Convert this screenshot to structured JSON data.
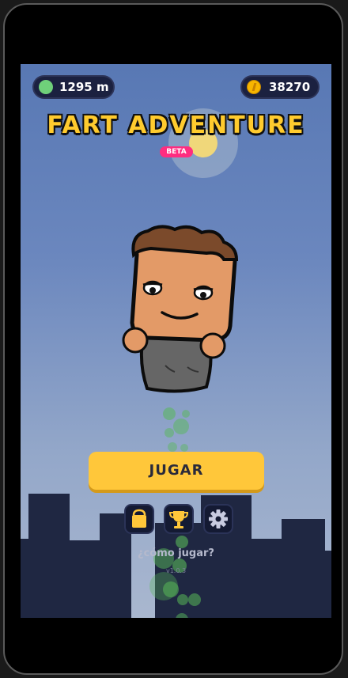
{
  "hud": {
    "distance": "1295 m",
    "coins": "38270"
  },
  "title": "FART ADVENTURE",
  "badge": "BETA",
  "play_button": "JUGAR",
  "icons": [
    "shop-icon",
    "trophy-icon",
    "settings-icon"
  ],
  "how_to_play": "¿cómo jugar?",
  "version": "v1.0.3",
  "colors": {
    "accent": "#ffc73a",
    "badge": "#ff2d80",
    "fart": "#58b858",
    "panel": "#1b2140"
  }
}
